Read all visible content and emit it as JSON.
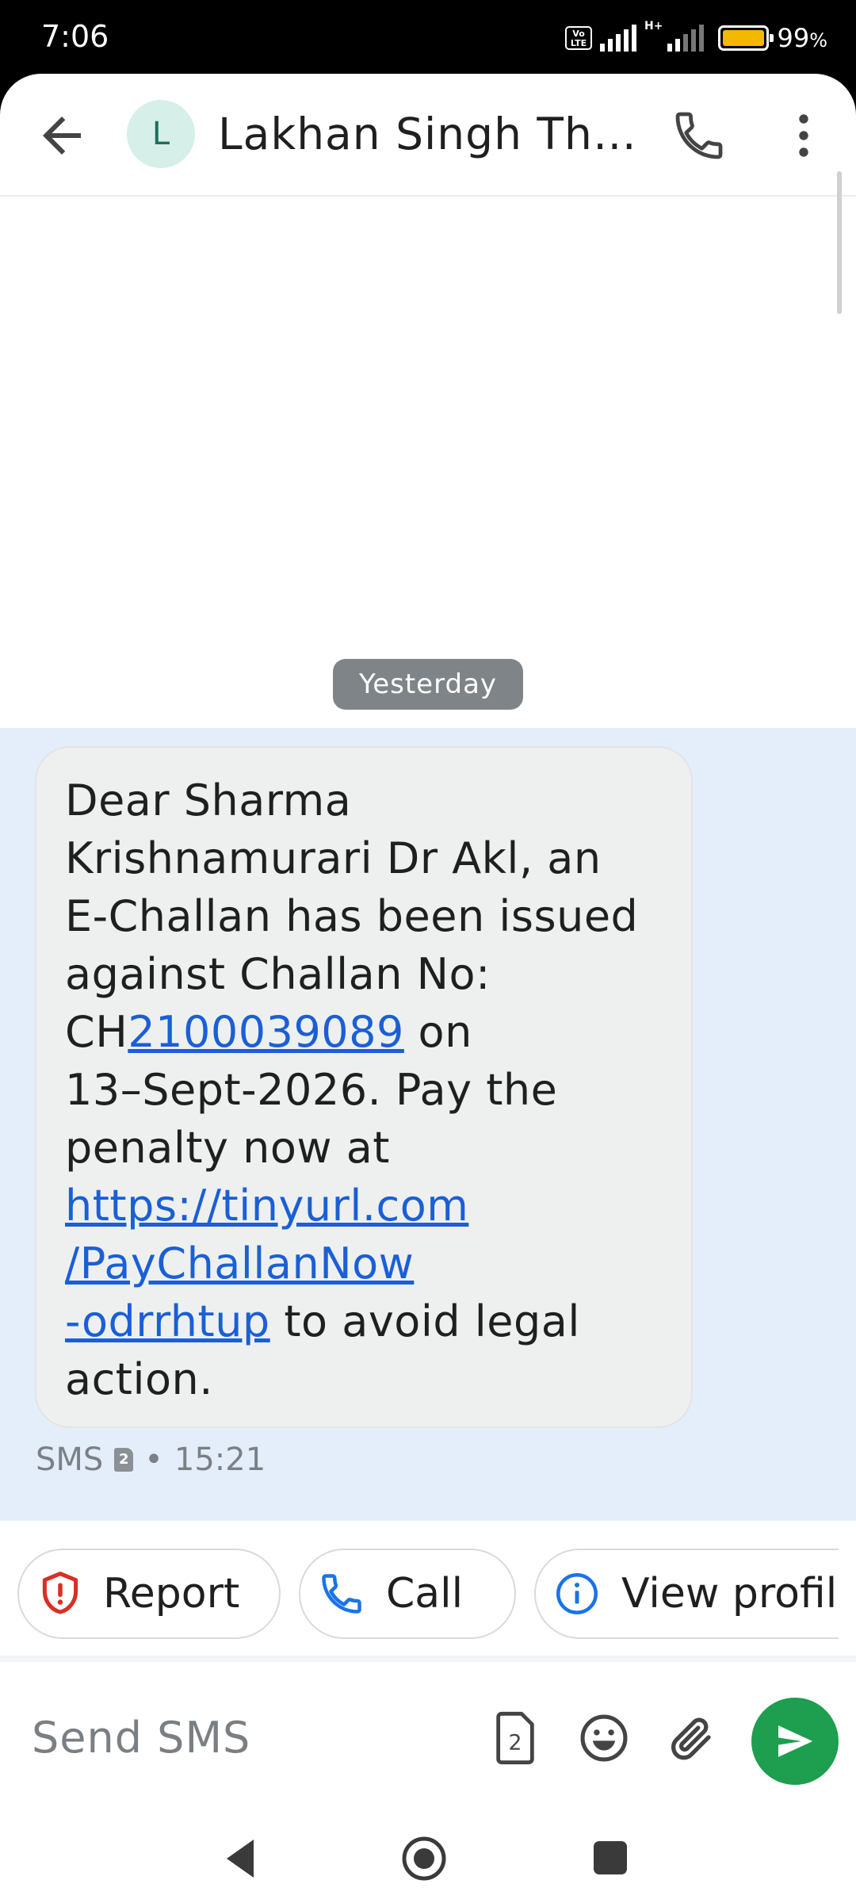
{
  "status_bar": {
    "time": "7:06",
    "volte": "Vo LTE",
    "network": "H+",
    "battery_percent": "99",
    "battery_unit": "%",
    "battery_level": 0.99,
    "battery_color": "#f5b800"
  },
  "header": {
    "back_icon": "arrow-left-icon",
    "avatar_letter": "L",
    "contact_name": "Lakhan Singh Th…",
    "call_icon": "phone-icon",
    "more_icon": "more-vert-icon"
  },
  "conversation": {
    "date_label": "Yesterday",
    "message": {
      "lines": [
        {
          "text": "Dear Sharma"
        },
        {
          "text": "Krishnamurari Dr Akl, an"
        },
        {
          "text": "E-Challan has been issued"
        },
        {
          "text": "against Challan No:"
        },
        {
          "prefix": "CH",
          "link": "2100039089",
          "suffix": " on"
        },
        {
          "text": "13–Sept-2026. Pay the"
        },
        {
          "text": "penalty now at"
        },
        {
          "link": "https://tinyurl.com"
        },
        {
          "link": "/PayChallanNow"
        },
        {
          "link": "-odrrhtup",
          "suffix": " to avoid legal"
        },
        {
          "text": "action."
        }
      ],
      "channel": "SMS",
      "sim_slot": "2",
      "separator": "•",
      "time": "15:21"
    },
    "accent_link_color": "#1a5fd6",
    "thread_background": "#e4eefb"
  },
  "suggestions": {
    "report_label": "Report",
    "call_label": "Call",
    "view_profile_label": "View profile"
  },
  "composer": {
    "placeholder": "Send SMS",
    "sim_label": "2",
    "send_color": "#1e9e4f"
  }
}
